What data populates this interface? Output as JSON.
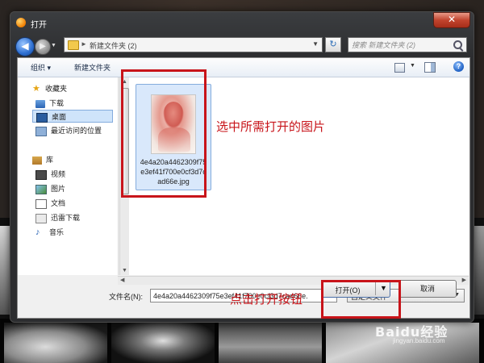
{
  "window": {
    "title": "打开",
    "close_glyph": "✕"
  },
  "nav": {
    "address_breadcrumb": "新建文件夹 (2)",
    "search_placeholder": "搜索 新建文件夹 (2)"
  },
  "toolbar": {
    "organize_label": "组织 ▾",
    "new_folder_label": "新建文件夹",
    "help_glyph": "?"
  },
  "sidebar": {
    "favorites_label": "收藏夹",
    "items_favorites": [
      {
        "label": "下载",
        "icon": "download-folder-icon"
      },
      {
        "label": "桌面",
        "icon": "desktop-icon"
      },
      {
        "label": "最近访问的位置",
        "icon": "recent-places-icon"
      }
    ],
    "libraries_label": "库",
    "items_libraries": [
      {
        "label": "视频",
        "icon": "video-icon"
      },
      {
        "label": "图片",
        "icon": "pictures-icon"
      },
      {
        "label": "文档",
        "icon": "documents-icon"
      },
      {
        "label": "迅雷下载",
        "icon": "xunlei-download-icon"
      },
      {
        "label": "音乐",
        "icon": "music-icon"
      }
    ]
  },
  "files": [
    {
      "name": "4e4a20a4462309f75e3ef41f700e0cf3d7cad66e.jpg"
    }
  ],
  "footer": {
    "filename_label": "文件名(N):",
    "filename_value": "4e4a20a4462309f75e3ef41f700e0cf3d7cad66e.",
    "filter_value": "自定义文件",
    "open_label": "打开(O)",
    "cancel_label": "取消"
  },
  "annotations": {
    "select_file_text": "选中所需打开的图片",
    "click_open_text": "点击打开按钮",
    "highlight_color": "#c8141a"
  },
  "watermark": {
    "brand": "Baidu经验",
    "url": "jingyan.baidu.com"
  }
}
